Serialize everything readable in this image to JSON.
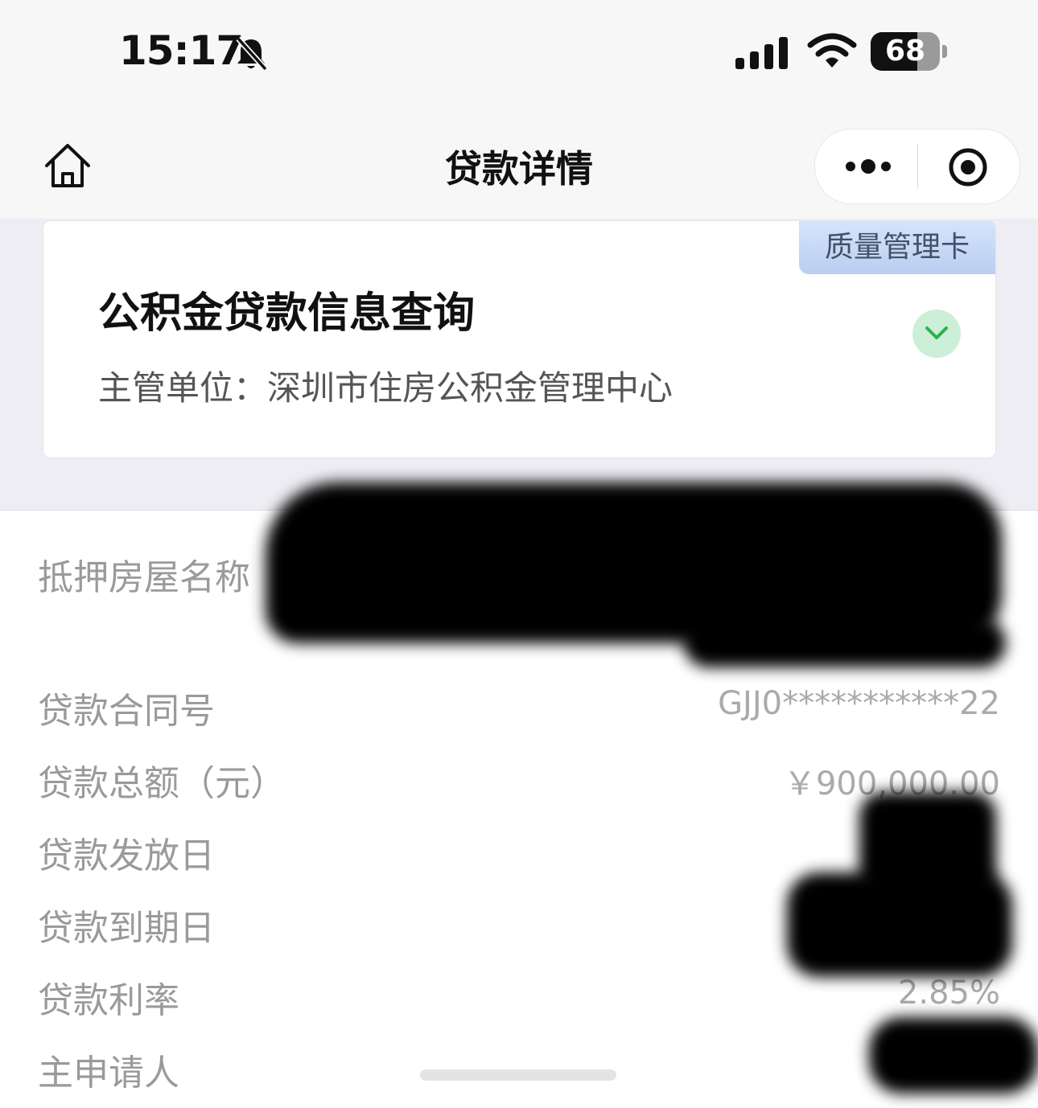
{
  "status_bar": {
    "time": "15:17",
    "battery_level": "68",
    "battery_fraction": 0.68,
    "icons": [
      "bell-muted-icon",
      "signal-icon",
      "wifi-icon",
      "battery-icon"
    ]
  },
  "nav": {
    "title": "贷款详情",
    "icons": [
      "home-icon",
      "more-icon",
      "target-icon"
    ]
  },
  "card": {
    "tag": "质量管理卡",
    "title": "公积金贷款信息查询",
    "subtitle": "主管单位：深圳市住房公积金管理中心",
    "toggle_icon": "chevron-down-icon",
    "toggle_color": "#2bb24c",
    "toggle_bg": "#ccefd7"
  },
  "details": [
    {
      "label": "抵押房屋名称",
      "value": ""
    },
    {
      "label": "贷款合同号",
      "value": "GJJ0***********22"
    },
    {
      "label": "贷款总额（元）",
      "value": "￥900,000.00"
    },
    {
      "label": "贷款发放日",
      "value": ""
    },
    {
      "label": "贷款到期日",
      "value": ""
    },
    {
      "label": "贷款利率",
      "value": "2.85%"
    },
    {
      "label": "主申请人",
      "value": ""
    }
  ]
}
